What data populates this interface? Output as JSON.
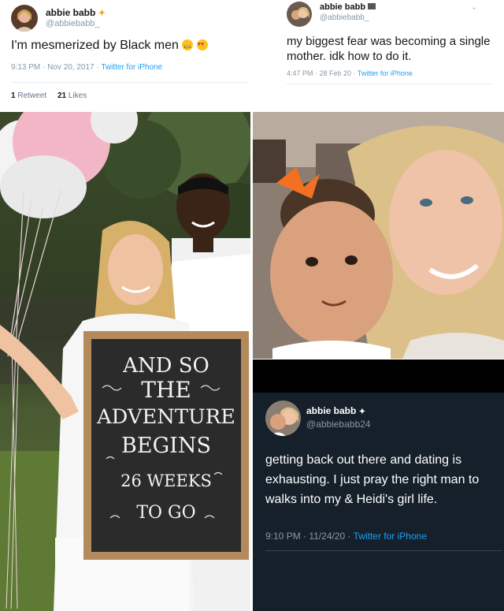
{
  "tweet1": {
    "name": "abbie babb",
    "name_icon": "sparkle-icon",
    "handle": "@abbiebabb_",
    "text": "I'm mesmerized by Black men",
    "emojis": [
      "grimace-emoji",
      "heart-eyes-emoji"
    ],
    "time": "9:13 PM · Nov 20, 2017 · ",
    "source": "Twitter for iPhone",
    "retweets_count": "1",
    "retweets_label": "Retweet",
    "likes_count": "21",
    "likes_label": "Likes"
  },
  "tweet2": {
    "name": "abbie babb",
    "name_icon": "flag-icon",
    "handle": "@abbiebabb_",
    "text": "my biggest fear was becoming a single mother. idk how to do it.",
    "time": "4:47 PM · 28 Feb 20 · ",
    "source": "Twitter for iPhone",
    "menu_icon": "chevron-down-icon"
  },
  "announcement_photo": {
    "sign_lines": [
      "AND SO",
      "THE",
      "ADVENTURE",
      "BEGINS",
      "26 WEEKS",
      "TO GO"
    ],
    "colors": {
      "grass": "#3f5a2a",
      "chalkboard": "#2b2b2b",
      "frame": "#b48a5c",
      "balloon_pink": "#f2b6c6"
    }
  },
  "tweet3": {
    "name": "abbie babb",
    "name_icon": "sparkle-icon",
    "handle": "@abbiebabb24",
    "text": "getting back out there and dating is exhausting. I just pray the right man to walks into my & Heidi's girl life.",
    "time": "9:10 PM · 11/24/20 · ",
    "source": "Twitter for iPhone",
    "colors": {
      "background": "#15202b",
      "link": "#1da1f2"
    }
  }
}
